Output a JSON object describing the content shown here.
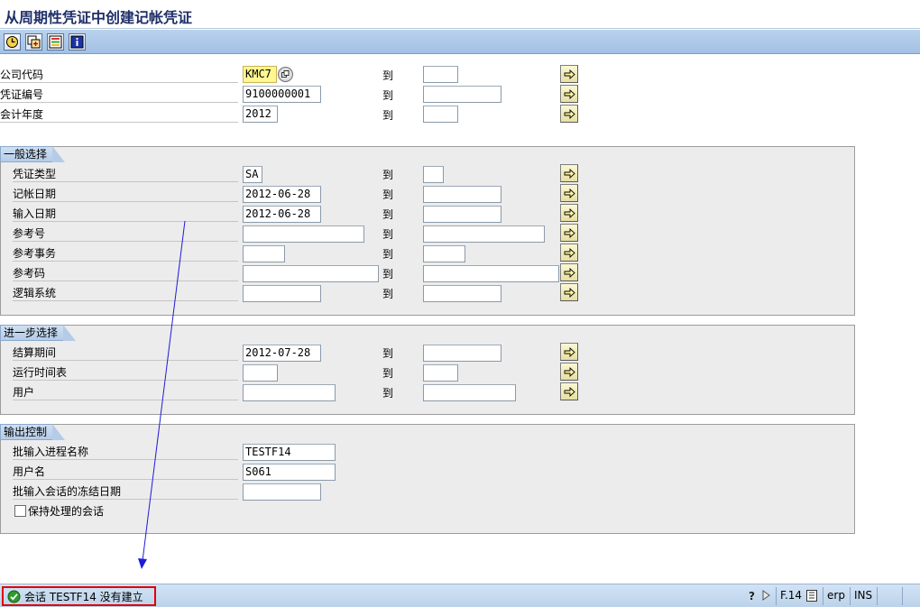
{
  "window": {
    "title": "从周期性凭证中创建记帐凭证"
  },
  "toolbar": {
    "icons": [
      "execute-icon",
      "get-variant-icon",
      "selection-options-icon",
      "info-icon"
    ]
  },
  "to_label": "到",
  "main": {
    "company_code": {
      "label": "公司代码",
      "from": "KMC7",
      "to": ""
    },
    "doc_number": {
      "label": "凭证编号",
      "from": "9100000001",
      "to": ""
    },
    "fiscal_year": {
      "label": "会计年度",
      "from": "2012",
      "to": ""
    }
  },
  "general": {
    "title": "一般选择",
    "doc_type": {
      "label": "凭证类型",
      "from": "SA",
      "to": ""
    },
    "posting_date": {
      "label": "记帐日期",
      "from": "2012-06-28",
      "to": ""
    },
    "entry_date": {
      "label": "输入日期",
      "from": "2012-06-28",
      "to": ""
    },
    "reference": {
      "label": "参考号",
      "from": "",
      "to": ""
    },
    "ref_transaction": {
      "label": "参考事务",
      "from": "",
      "to": ""
    },
    "ref_key": {
      "label": "参考码",
      "from": "",
      "to": ""
    },
    "logical_system": {
      "label": "逻辑系统",
      "from": "",
      "to": ""
    }
  },
  "further": {
    "title": "进一步选择",
    "settlement_period": {
      "label": "结算期间",
      "from": "2012-07-28",
      "to": ""
    },
    "run_schedule": {
      "label": "运行时间表",
      "from": "",
      "to": ""
    },
    "user": {
      "label": "用户",
      "from": "",
      "to": ""
    }
  },
  "output": {
    "title": "输出控制",
    "batch_session": {
      "label": "批输入进程名称",
      "value": "TESTF14"
    },
    "user_name": {
      "label": "用户名",
      "value": "S061"
    },
    "lock_date": {
      "label": "批输入会话的冻结日期",
      "value": ""
    },
    "keep_session": {
      "label": "保持处理的会话",
      "checked": false
    }
  },
  "status": {
    "message": "会话 TESTF14 没有建立",
    "transaction": "F.14",
    "system": "erp",
    "mode": "INS"
  },
  "colors": {
    "annotation_arrow": "#1c1cd8",
    "highlight_box": "#e00000",
    "required_field": "#fff790"
  }
}
